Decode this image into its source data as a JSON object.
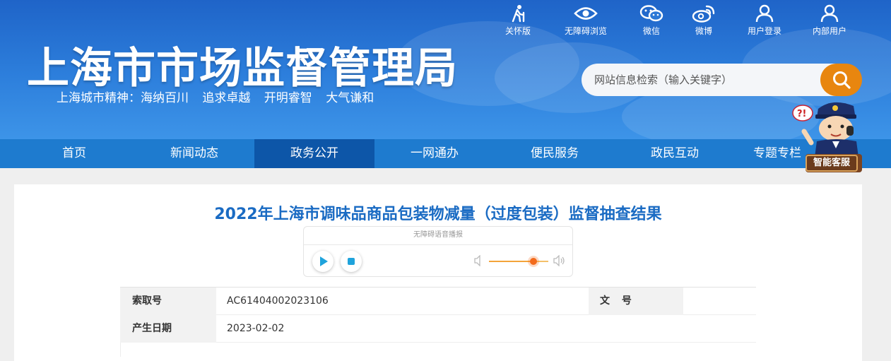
{
  "header": {
    "site_title": "上海市市场监督管理局",
    "motto": "上海城市精神：海纳百川 追求卓越 开明睿智 大气谦和"
  },
  "toolbar": [
    {
      "label": "关怀版",
      "icon": "elderly-care-icon"
    },
    {
      "label": "无障碍浏览",
      "icon": "eye-icon"
    },
    {
      "label": "微信",
      "icon": "wechat-icon"
    },
    {
      "label": "微博",
      "icon": "weibo-icon"
    },
    {
      "label": "用户登录",
      "icon": "user-icon"
    },
    {
      "label": "内部用户",
      "icon": "user-icon"
    }
  ],
  "search": {
    "placeholder": "网站信息检索（输入关键字）",
    "button_icon": "search-icon"
  },
  "nav": {
    "items": [
      "首页",
      "新闻动态",
      "政务公开",
      "一网通办",
      "便民服务",
      "政民互动",
      "专题专栏"
    ],
    "active": "政务公开"
  },
  "assistant": {
    "label": "智能客服",
    "icon": "police-mascot-icon"
  },
  "article": {
    "title": "2022年上海市调味品商品包装物减量（过度包装）监督抽查结果"
  },
  "player": {
    "header": "无障碍语音播报",
    "volume_fraction": 0.75
  },
  "meta": {
    "index_label": "索取号",
    "index_value": "AC61404002023106",
    "doc_no_label": "文 号",
    "date_label": "产生日期",
    "date_value": "2023-02-02"
  },
  "colors": {
    "header_blue": "#2d7fdc",
    "nav_blue": "#1e7bcf",
    "nav_active": "#0d56a8",
    "search_orange": "#e8860f",
    "title_blue": "#1a6bc3"
  }
}
